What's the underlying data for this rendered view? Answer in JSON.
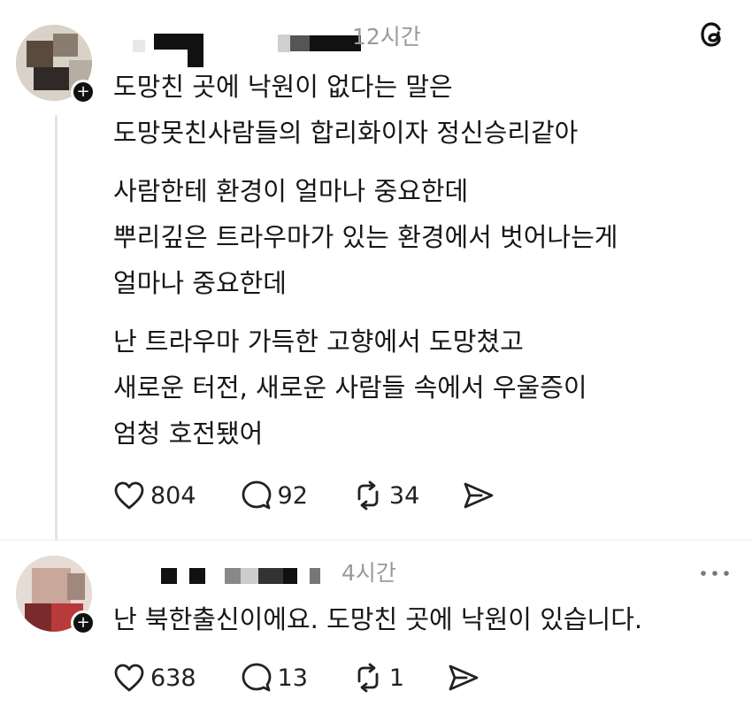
{
  "post1": {
    "time": "12시간",
    "lines_p1": [
      "도망친 곳에 낙원이 없다는 말은",
      "도망못친사람들의 합리화이자 정신승리같아"
    ],
    "lines_p2": [
      "사람한테 환경이 얼마나 중요한데",
      "뿌리깊은 트라우마가 있는 환경에서 벗어나는게",
      "얼마나 중요한데"
    ],
    "lines_p3": [
      "난 트라우마 가득한 고향에서 도망쳤고",
      "새로운 터전, 새로운 사람들 속에서 우울증이",
      "엄청 호전됐어"
    ],
    "likes": "804",
    "replies": "92",
    "reposts": "34"
  },
  "post2": {
    "time": "4시간",
    "line": "난 북한출신이에요. 도망친 곳에 낙원이 있습니다.",
    "likes": "638",
    "replies": "13",
    "reposts": "1"
  },
  "icons": {
    "threads": "threads-logo-icon",
    "like": "heart-icon",
    "reply": "comment-bubble-icon",
    "repost": "repost-icon",
    "share": "send-icon",
    "more": "more-icon"
  }
}
